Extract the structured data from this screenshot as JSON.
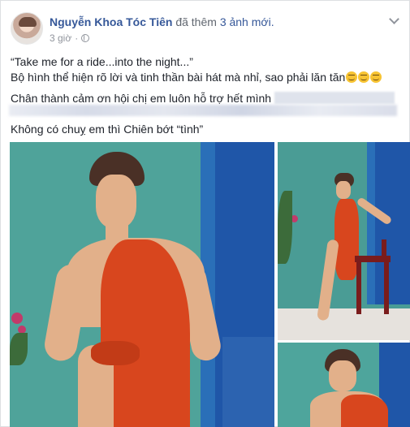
{
  "post": {
    "author": "Nguyễn Khoa Tóc Tiên",
    "action": "đã thêm",
    "action_link": "3 ảnh mới.",
    "time": "3 giờ",
    "separator": "·",
    "lines": [
      "“Take me for a ride...into the night...”",
      "Bộ hình thể hiện rõ lời và tinh thần bài hát mà nhỉ, sao phải lăn tăn",
      "Chân thành cảm ơn hội chị em luôn hỗ trợ hết mình",
      "Không có chuỵ em thì Chiên bớt “tình”"
    ],
    "emojis": [
      "smirk-emoji",
      "smirk-emoji",
      "smirk-emoji"
    ]
  },
  "photos": [
    "photo-main",
    "photo-top-right",
    "photo-bottom-right"
  ],
  "colors": {
    "author": "#365899",
    "meta": "#90949c",
    "teal_wall": "#4fa39a",
    "blue_door": "#1f56a8",
    "dress": "#d8461e"
  }
}
